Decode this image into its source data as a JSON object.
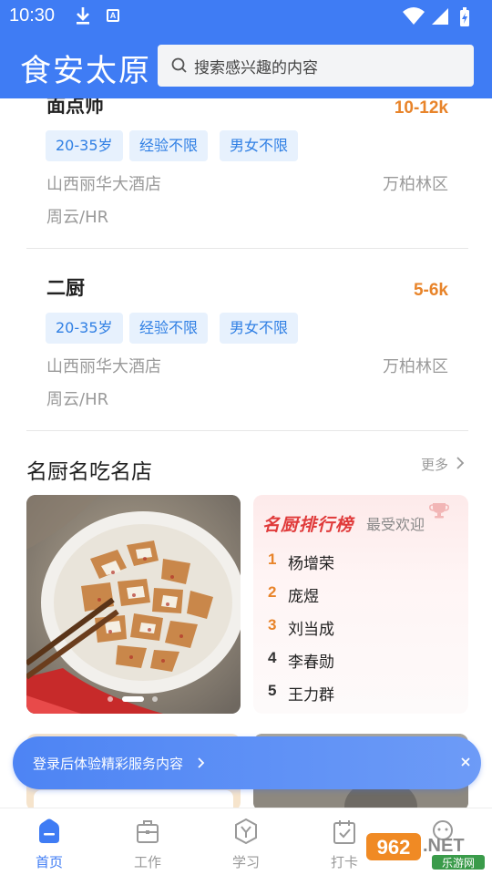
{
  "status_bar": {
    "time": "10:30",
    "icons": [
      "download-icon",
      "a-icon",
      "wifi-icon",
      "signal-icon",
      "battery-icon"
    ]
  },
  "header": {
    "brand": "食安太原",
    "search_placeholder": "搜索感兴趣的内容"
  },
  "jobs": [
    {
      "title": "面点师",
      "salary": "10-12k",
      "tags": [
        "20-35岁",
        "经验不限",
        "男女不限"
      ],
      "company": "山西丽华大酒店",
      "district": "万柏林区",
      "hr": "周云/HR"
    },
    {
      "title": "二厨",
      "salary": "5-6k",
      "tags": [
        "20-35岁",
        "经验不限",
        "男女不限"
      ],
      "company": "山西丽华大酒店",
      "district": "万柏林区",
      "hr": "周云/HR"
    }
  ],
  "section": {
    "title": "名厨名吃名店",
    "more": "更多"
  },
  "ranking": {
    "title": "名厨排行榜",
    "subtitle": "最受欢迎",
    "items": [
      {
        "rank": "1",
        "name": "杨增荣"
      },
      {
        "rank": "2",
        "name": "庞煜"
      },
      {
        "rank": "3",
        "name": "刘当成"
      },
      {
        "rank": "4",
        "name": "李春勋"
      },
      {
        "rank": "5",
        "name": "王力群"
      }
    ]
  },
  "banner": {
    "text": "登录后体验精彩服务内容"
  },
  "nav": [
    {
      "label": "首页",
      "active": true
    },
    {
      "label": "工作",
      "active": false
    },
    {
      "label": "学习",
      "active": false
    },
    {
      "label": "打卡",
      "active": false
    }
  ],
  "watermark": {
    "text": "962.NET",
    "sub": "乐游网"
  },
  "colors": {
    "primary": "#3f7cf4",
    "salary": "#e8842a",
    "tag_bg": "#e7f1fd",
    "tag_text": "#2f7fe4",
    "rank_title": "#e03a3a",
    "rank_top3": "#e8842a"
  }
}
